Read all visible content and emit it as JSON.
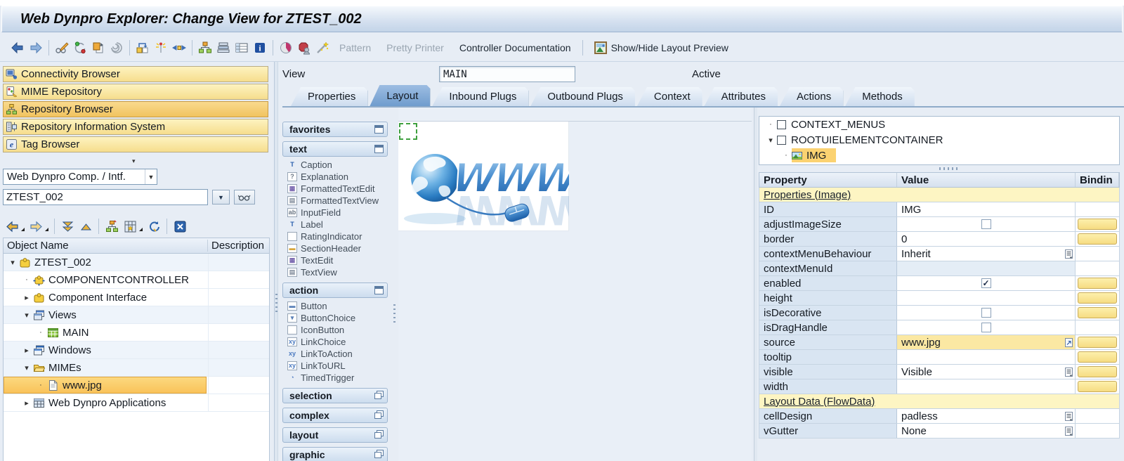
{
  "title": "Web Dynpro Explorer: Change View for ZTEST_002",
  "toolbar": {
    "pattern": "Pattern",
    "pretty_printer": "Pretty Printer",
    "controller_documentation": "Controller Documentation",
    "show_hide_layout_preview": "Show/Hide Layout Preview"
  },
  "sidebar": {
    "browsers": [
      {
        "label": "Connectivity Browser",
        "icon": "connectivity",
        "active": false
      },
      {
        "label": "MIME Repository",
        "icon": "mime",
        "active": false
      },
      {
        "label": "Repository Browser",
        "icon": "repository",
        "active": true
      },
      {
        "label": "Repository Information System",
        "icon": "infosys",
        "active": false
      },
      {
        "label": "Tag Browser",
        "icon": "tag",
        "active": false
      }
    ],
    "category_select": "Web Dynpro Comp. / Intf.",
    "object_input": "ZTEST_002",
    "tree_header": {
      "name": "Object Name",
      "description": "Description"
    },
    "tree": [
      {
        "label": "ZTEST_002",
        "level": 0,
        "expander": "open",
        "icon": "component",
        "tint": true
      },
      {
        "label": "COMPONENTCONTROLLER",
        "level": 1,
        "expander": "leaf",
        "icon": "controller"
      },
      {
        "label": "Component Interface",
        "level": 1,
        "expander": "closed",
        "icon": "component"
      },
      {
        "label": "Views",
        "level": 1,
        "expander": "open",
        "icon": "views",
        "tint": true
      },
      {
        "label": "MAIN",
        "level": 2,
        "expander": "leaf",
        "icon": "view"
      },
      {
        "label": "Windows",
        "level": 1,
        "expander": "closed",
        "icon": "windows",
        "tint": true
      },
      {
        "label": "MIMEs",
        "level": 1,
        "expander": "open",
        "icon": "folder",
        "tint": true
      },
      {
        "label": "www.jpg",
        "level": 2,
        "expander": "leaf",
        "icon": "file",
        "selected": true
      },
      {
        "label": "Web Dynpro Applications",
        "level": 1,
        "expander": "closed",
        "icon": "applications"
      }
    ]
  },
  "main": {
    "view_label": "View",
    "view_name": "MAIN",
    "view_status": "Active",
    "tabs": [
      {
        "label": "Properties"
      },
      {
        "label": "Layout",
        "active": true
      },
      {
        "label": "Inbound Plugs"
      },
      {
        "label": "Outbound Plugs"
      },
      {
        "label": "Context"
      },
      {
        "label": "Attributes"
      },
      {
        "label": "Actions"
      },
      {
        "label": "Methods"
      }
    ],
    "palette": [
      {
        "label": "favorites",
        "collapsed": false,
        "items": []
      },
      {
        "label": "text",
        "collapsed": false,
        "items": [
          {
            "label": "Caption",
            "icon": "caption"
          },
          {
            "label": "Explanation",
            "icon": "explanation"
          },
          {
            "label": "FormattedTextEdit",
            "icon": "formattedtextedit"
          },
          {
            "label": "FormattedTextView",
            "icon": "formattedtextview"
          },
          {
            "label": "InputField",
            "icon": "inputfield"
          },
          {
            "label": "Label",
            "icon": "label"
          },
          {
            "label": "RatingIndicator",
            "icon": "ratingindicator"
          },
          {
            "label": "SectionHeader",
            "icon": "sectionheader"
          },
          {
            "label": "TextEdit",
            "icon": "textedit"
          },
          {
            "label": "TextView",
            "icon": "textview"
          }
        ]
      },
      {
        "label": "action",
        "collapsed": false,
        "items": [
          {
            "label": "Button",
            "icon": "button"
          },
          {
            "label": "ButtonChoice",
            "icon": "buttonchoice"
          },
          {
            "label": "IconButton",
            "icon": "iconbutton"
          },
          {
            "label": "LinkChoice",
            "icon": "linkchoice"
          },
          {
            "label": "LinkToAction",
            "icon": "linktoaction"
          },
          {
            "label": "LinkToURL",
            "icon": "linktourl"
          },
          {
            "label": "TimedTrigger",
            "icon": "timedtrigger"
          }
        ]
      },
      {
        "label": "selection",
        "collapsed": true,
        "items": []
      },
      {
        "label": "complex",
        "collapsed": true,
        "items": []
      },
      {
        "label": "layout",
        "collapsed": true,
        "items": []
      },
      {
        "label": "graphic",
        "collapsed": true,
        "items": []
      }
    ]
  },
  "inspector": {
    "tree": [
      {
        "label": "CONTEXT_MENUS",
        "level": 0,
        "expander": "leaf",
        "icon": "box"
      },
      {
        "label": "ROOTUIELEMENTCONTAINER",
        "level": 0,
        "expander": "open",
        "icon": "box"
      },
      {
        "label": "IMG",
        "level": 1,
        "expander": "leaf",
        "icon": "img",
        "selected": true
      }
    ],
    "table": {
      "headers": [
        "Property",
        "Value",
        "Bindin"
      ],
      "rows": [
        {
          "type": "section",
          "property": "Properties (Image)"
        },
        {
          "property": "ID",
          "value": "IMG"
        },
        {
          "property": "adjustImageSize",
          "control": "checkbox",
          "checked": false,
          "binding": true
        },
        {
          "property": "border",
          "value": "0",
          "binding": true
        },
        {
          "property": "contextMenuBehaviour",
          "value": "Inherit",
          "dropdown": true
        },
        {
          "property": "contextMenuId",
          "dim": true
        },
        {
          "property": "enabled",
          "control": "checkbox",
          "checked": true,
          "binding": true
        },
        {
          "property": "height",
          "binding": true
        },
        {
          "property": "isDecorative",
          "control": "checkbox",
          "checked": false,
          "binding": true
        },
        {
          "property": "isDragHandle",
          "control": "checkbox",
          "checked": false
        },
        {
          "property": "source",
          "value": "www.jpg",
          "highlight": true,
          "open_icon": true,
          "binding": true
        },
        {
          "property": "tooltip",
          "binding": true
        },
        {
          "property": "visible",
          "value": "Visible",
          "dropdown": true,
          "binding": true
        },
        {
          "property": "width",
          "binding": true
        },
        {
          "type": "section",
          "property": "Layout Data (FlowData)"
        },
        {
          "property": "cellDesign",
          "value": "padless",
          "dropdown": true
        },
        {
          "property": "vGutter",
          "value": "None",
          "dropdown": true
        }
      ]
    }
  },
  "colors": {
    "accent_yellow": "#f6dd8d",
    "selection_orange": "#f9c35a",
    "tab_active": "#6f9ccd",
    "section_yellow": "#fdf5c3",
    "annotation_red": "#d4362a"
  }
}
